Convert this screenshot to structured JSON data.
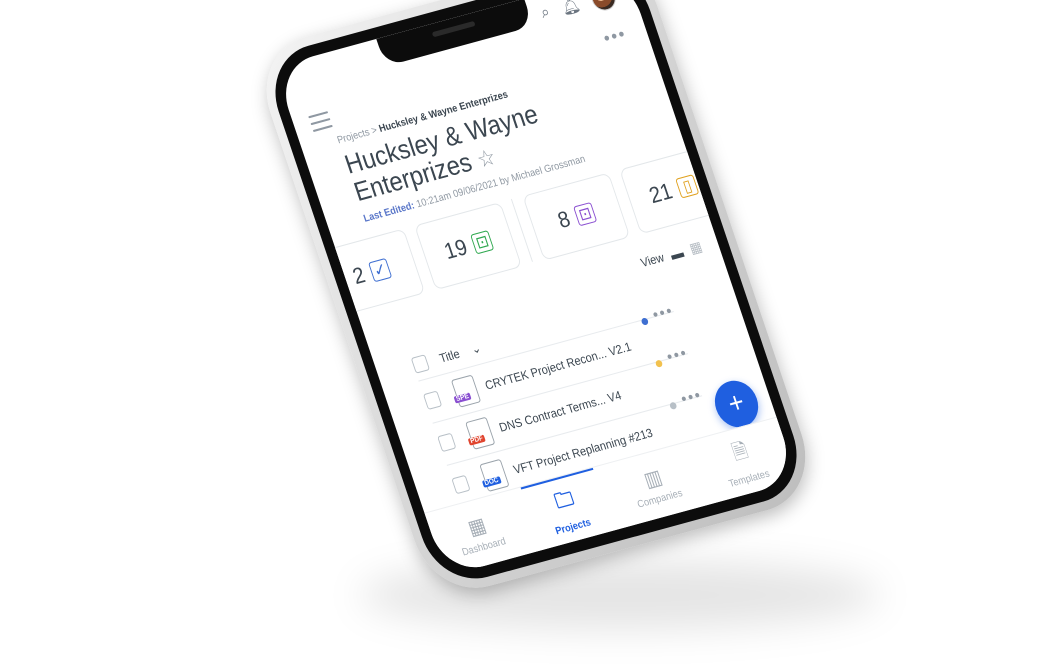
{
  "colors": {
    "accent": "#1f5fe0",
    "text": "#3b4650",
    "muted": "#8f98a2"
  },
  "header": {
    "more_icon": "more-horizontal-icon"
  },
  "breadcrumb": {
    "root": "Projects",
    "separator": " > ",
    "current": "Hucksley & Wayne Enterprizes"
  },
  "project": {
    "title": "Hucksley & Wayne Enterprizes",
    "last_edited_label": "Last Edited:",
    "last_edited_value": "10:21am 09/06/2021 by Michael Grossman"
  },
  "stats": [
    {
      "value": "2",
      "icon": "check-doc-icon",
      "color": "#3f6fd1"
    },
    {
      "value": "19",
      "icon": "lock-doc-icon",
      "color": "#2fa84f"
    },
    {
      "value": "8",
      "icon": "lock-doc-icon",
      "color": "#8a4fd1"
    },
    {
      "value": "21",
      "icon": "doc-icon",
      "color": "#e0a11f"
    }
  ],
  "view": {
    "label": "View",
    "list_icon": "list-view-icon",
    "grid_icon": "grid-view-icon"
  },
  "list": {
    "column_title": "Title",
    "rows": [
      {
        "name": "CRYTEK Project Recon... V2.1",
        "type": "SPE",
        "type_color": "#8a4fd1",
        "dot_color": "#3f6fd1"
      },
      {
        "name": "DNS Contract Terms... V4",
        "type": "PDF",
        "type_color": "#e0452f",
        "dot_color": "#f2c14e"
      },
      {
        "name": "VFT Project Replanning #213",
        "type": "DOC",
        "type_color": "#1f5fe0",
        "dot_color": "#b8c0c7"
      }
    ]
  },
  "fab": {
    "label": "+"
  },
  "nav": [
    {
      "label": "Dashboard",
      "icon": "dashboard-icon",
      "glyph": "▦"
    },
    {
      "label": "Projects",
      "icon": "folder-icon",
      "glyph": "🗀"
    },
    {
      "label": "Companies",
      "icon": "buildings-icon",
      "glyph": "▥"
    },
    {
      "label": "Templates",
      "icon": "template-icon",
      "glyph": "🗎"
    }
  ]
}
